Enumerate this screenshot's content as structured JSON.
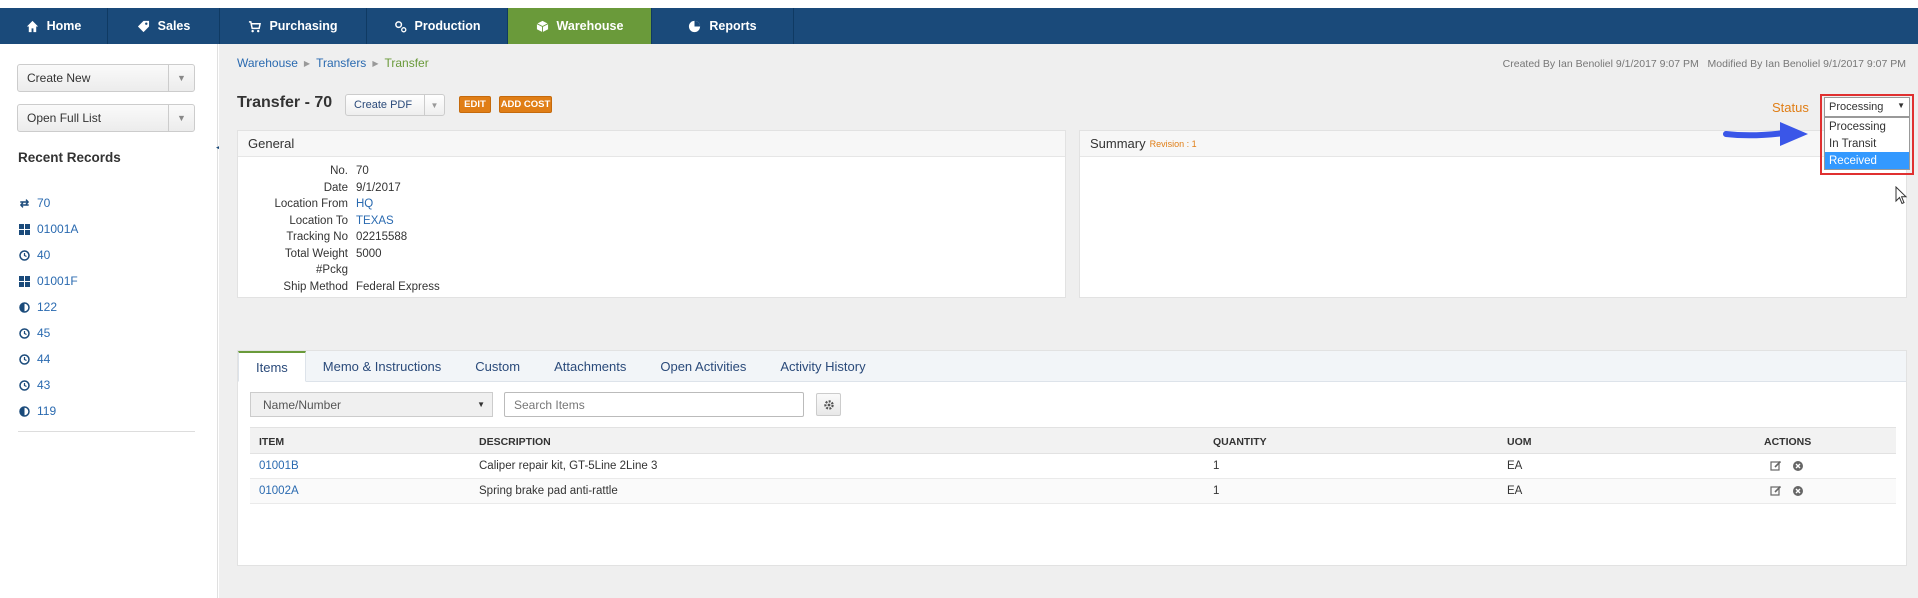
{
  "nav": {
    "items": [
      {
        "label": "Home",
        "icon": "home-icon"
      },
      {
        "label": "Sales",
        "icon": "tag-icon"
      },
      {
        "label": "Purchasing",
        "icon": "cart-icon"
      },
      {
        "label": "Production",
        "icon": "gears-icon"
      },
      {
        "label": "Warehouse",
        "icon": "box-icon",
        "active": true
      },
      {
        "label": "Reports",
        "icon": "pie-chart-icon"
      }
    ],
    "colors": {
      "bar": "#1a4a7a",
      "active": "#6a9a3a"
    }
  },
  "sidebar": {
    "create_new": "Create New",
    "open_full_list": "Open Full List",
    "recent_title": "Recent Records",
    "recent": [
      {
        "label": "70",
        "icon": "transfer-icon"
      },
      {
        "label": "01001A",
        "icon": "grid-icon"
      },
      {
        "label": "40",
        "icon": "clock-icon"
      },
      {
        "label": "01001F",
        "icon": "grid-icon"
      },
      {
        "label": "122",
        "icon": "half-circle-icon"
      },
      {
        "label": "45",
        "icon": "clock-icon"
      },
      {
        "label": "44",
        "icon": "clock-icon"
      },
      {
        "label": "43",
        "icon": "clock-icon"
      },
      {
        "label": "119",
        "icon": "half-circle-icon"
      }
    ]
  },
  "breadcrumb": [
    "Warehouse",
    "Transfers",
    "Transfer"
  ],
  "meta": "Created By Ian Benoliel 9/1/2017 9:07 PM   Modified By Ian Benoliel 9/1/2017 9:07 PM",
  "header": {
    "title": "Transfer - 70",
    "create_pdf": "Create PDF",
    "edit": "EDIT",
    "add_cost": "ADD COST",
    "status_label": "Status",
    "status_value": "Processing",
    "status_options": [
      "Processing",
      "In Transit",
      "Received"
    ],
    "highlighted_option": "Received"
  },
  "general": {
    "title": "General",
    "fields": [
      {
        "label": "No.",
        "value": "70",
        "link": false
      },
      {
        "label": "Date",
        "value": "9/1/2017",
        "link": false
      },
      {
        "label": "Location From",
        "value": "HQ",
        "link": true
      },
      {
        "label": "Location To",
        "value": "TEXAS",
        "link": true
      },
      {
        "label": "Tracking No",
        "value": "02215588",
        "link": false
      },
      {
        "label": "Total Weight",
        "value": "5000",
        "link": false
      },
      {
        "label": "#Pckg",
        "value": "",
        "link": false
      },
      {
        "label": "Ship Method",
        "value": "Federal Express",
        "link": false
      }
    ]
  },
  "summary": {
    "title": "Summary",
    "revision": "Revision : 1"
  },
  "tabs": [
    "Items",
    "Memo & Instructions",
    "Custom",
    "Attachments",
    "Open Activities",
    "Activity History"
  ],
  "items": {
    "filter": "Name/Number",
    "search_placeholder": "Search Items",
    "columns": [
      "ITEM",
      "DESCRIPTION",
      "QUANTITY",
      "UOM",
      "ACTIONS"
    ],
    "rows": [
      {
        "item": "01001B",
        "description": "Caliper repair kit, GT-5Line 2Line 3",
        "quantity": "1",
        "uom": "EA"
      },
      {
        "item": "01002A",
        "description": "Spring brake pad anti-rattle",
        "quantity": "1",
        "uom": "EA"
      }
    ]
  }
}
